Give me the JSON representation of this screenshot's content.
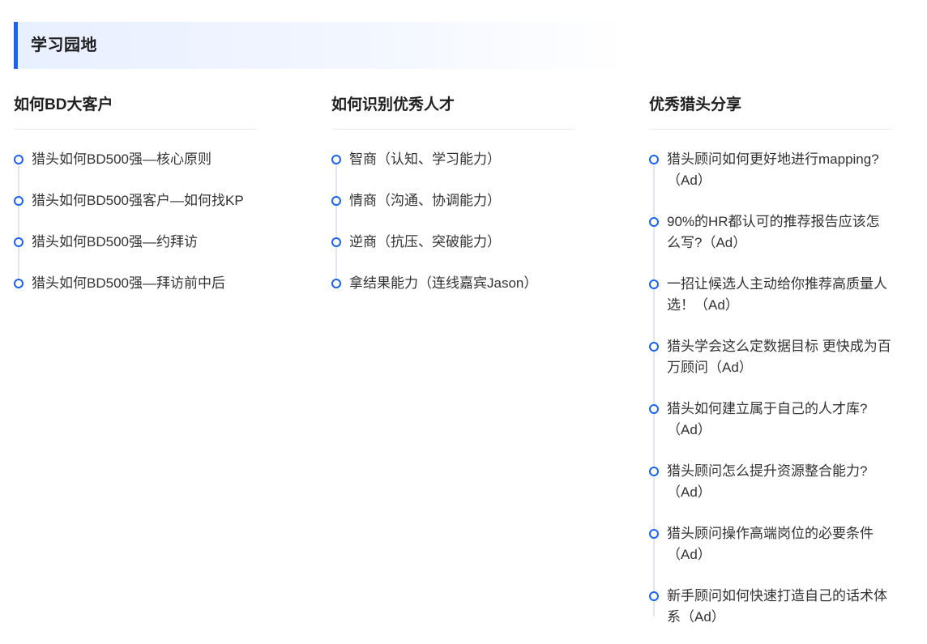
{
  "section": {
    "title": "学习园地",
    "accent_color": "#1a62f0"
  },
  "columns": [
    {
      "title": "如何BD大客户",
      "items": [
        "猎头如何BD500强—核心原则",
        "猎头如何BD500强客户—如何找KP",
        "猎头如何BD500强—约拜访",
        "猎头如何BD500强—拜访前中后"
      ]
    },
    {
      "title": "如何识别优秀人才",
      "items": [
        "智商（认知、学习能力）",
        "情商（沟通、协调能力）",
        "逆商（抗压、突破能力）",
        "拿结果能力（连线嘉宾Jason）"
      ]
    },
    {
      "title": "优秀猎头分享",
      "items": [
        "猎头顾问如何更好地进行mapping?（Ad）",
        "90%的HR都认可的推荐报告应该怎么写?（Ad）",
        "一招让候选人主动给你推荐高质量人选！（Ad）",
        "猎头学会这么定数据目标 更快成为百万顾问（Ad）",
        "猎头如何建立属于自己的人才库?（Ad）",
        "猎头顾问怎么提升资源整合能力?（Ad）",
        "猎头顾问操作高端岗位的必要条件（Ad）",
        "新手顾问如何快速打造自己的话术体系（Ad）"
      ]
    }
  ]
}
